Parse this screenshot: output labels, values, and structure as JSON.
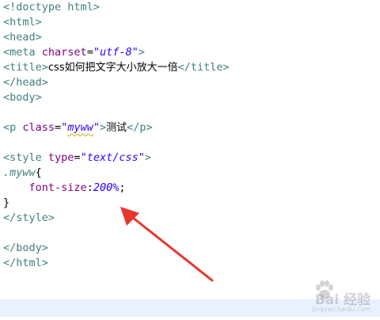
{
  "code": {
    "l1": "<!doctype html>",
    "l2": "<html>",
    "l3": "<head>",
    "l4_open": "<meta ",
    "l4_attr": "charset",
    "l4_eq": "=",
    "l4_val": "\"utf-8\"",
    "l4_close": ">",
    "l5_open": "<title>",
    "l5_text": "css如何把文字大小放大一倍",
    "l5_close": "</title>",
    "l6": "</head>",
    "l7": "<body>",
    "l9_open": "<p ",
    "l9_attr": "class",
    "l9_eq": "=",
    "l9_q1": "\"",
    "l9_val": "myww",
    "l9_q2": "\"",
    "l9_gt": ">",
    "l9_text": "测试",
    "l9_close": "</p>",
    "l11_open": "<style ",
    "l11_attr": "type",
    "l11_eq": "=",
    "l11_val": "\"text/css\"",
    "l11_close": ">",
    "l12_sel": ".myww",
    "l12_brace": "{",
    "l13_prop": "font-size",
    "l13_colon": ":",
    "l13_val": "200%",
    "l13_semi": ";",
    "l14": "}",
    "l15": "</style>",
    "l17": "</body>",
    "l18": "</html>"
  },
  "annotation": {
    "arrow_color": "#e8372d"
  },
  "watermark": {
    "text": "Bai 经验",
    "sub": "jingyan.baidu.com"
  }
}
